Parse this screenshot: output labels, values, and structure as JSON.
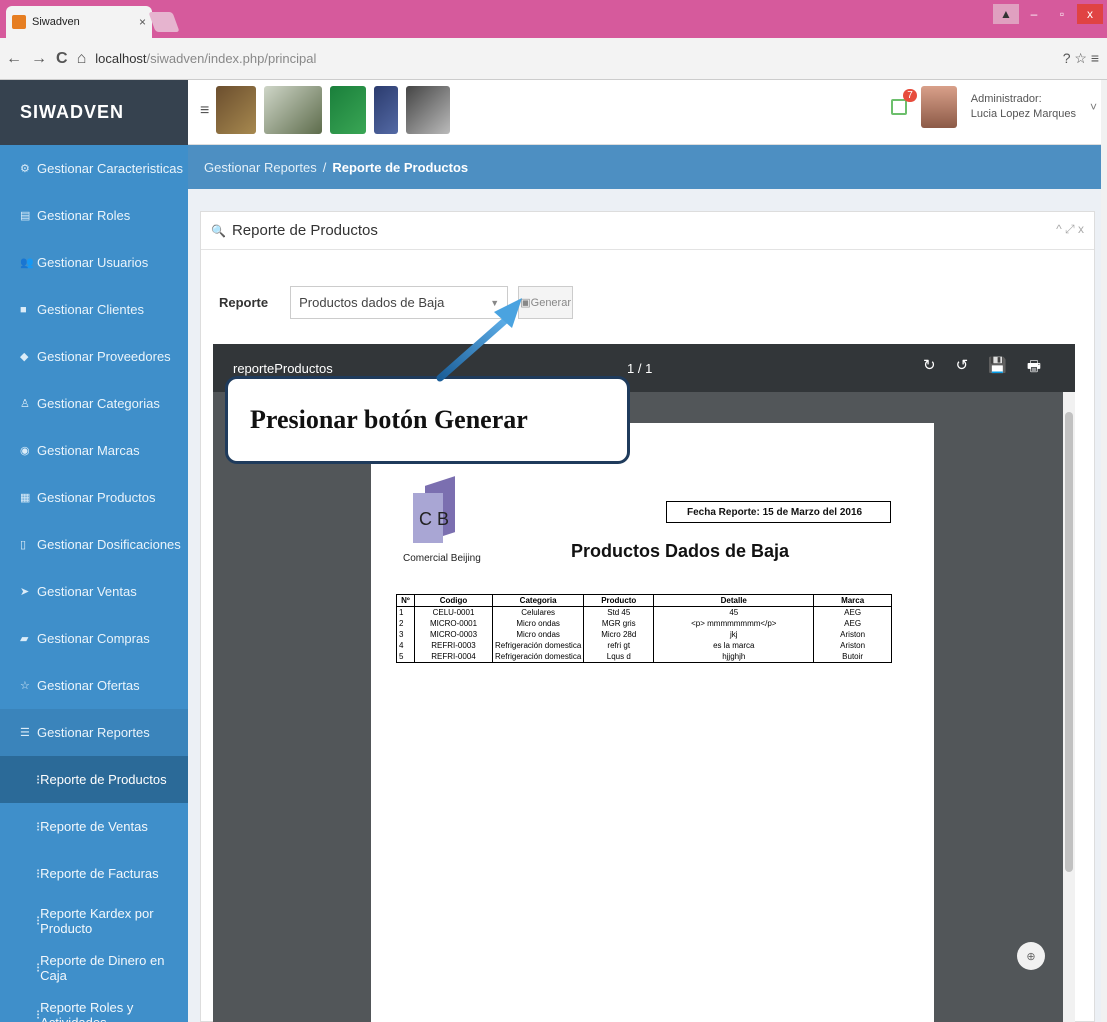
{
  "browser": {
    "tab_title": "Siwadven",
    "tab_close": "×",
    "url_host": "localhost",
    "url_path": "/siwadven/index.php/principal",
    "nav": {
      "back": "←",
      "forward": "→",
      "reload": "C",
      "home": "⌂"
    },
    "right_icons": "? ☆ ≡",
    "window": {
      "user": "▲",
      "minimize": "–",
      "maximize": "▫",
      "close": "x"
    }
  },
  "header": {
    "brand": "SIWADVEN",
    "hamburger": "≡",
    "notification_count": "7",
    "user_role": "Administrador:",
    "user_name": "Lucia Lopez Marques",
    "user_chevron": "˅"
  },
  "sidebar": {
    "items": [
      {
        "icon": "⚙",
        "label": "Gestionar Caracteristicas"
      },
      {
        "icon": "▤",
        "label": "Gestionar Roles"
      },
      {
        "icon": "👥",
        "label": "Gestionar Usuarios"
      },
      {
        "icon": "■",
        "label": "Gestionar Clientes"
      },
      {
        "icon": "◆",
        "label": "Gestionar Proveedores"
      },
      {
        "icon": "♙",
        "label": "Gestionar Categorias"
      },
      {
        "icon": "◉",
        "label": "Gestionar Marcas"
      },
      {
        "icon": "▦",
        "label": "Gestionar Productos"
      },
      {
        "icon": "▯",
        "label": "Gestionar Dosificaciones"
      },
      {
        "icon": "➤",
        "label": "Gestionar Ventas"
      },
      {
        "icon": "▰",
        "label": "Gestionar Compras"
      },
      {
        "icon": "☆",
        "label": "Gestionar Ofertas"
      },
      {
        "icon": "☰",
        "label": "Gestionar Reportes"
      }
    ],
    "subitems": [
      {
        "label": "Reporte de Productos"
      },
      {
        "label": "Reporte de Ventas"
      },
      {
        "label": "Reporte de Facturas"
      },
      {
        "label": "Reporte Kardex por Producto"
      },
      {
        "label": "Reporte de Dinero en Caja"
      },
      {
        "label": "Reporte Roles y Actividades"
      }
    ],
    "sub_icon": "⁝"
  },
  "breadcrumb": {
    "parent": "Gestionar Reportes",
    "separator": "/",
    "current": "Reporte de Productos"
  },
  "panel": {
    "title": "Reporte de Productos",
    "search_icon": "🔍",
    "tools": "^ ⤢ x",
    "report_label": "Reporte",
    "report_selected": "Productos dados de Baja",
    "generate_label": "Generar"
  },
  "viewer": {
    "filename": "reporteProductos",
    "pages": "1 / 1",
    "icons": [
      "↻",
      "↺",
      "💾",
      "🖶"
    ]
  },
  "report": {
    "logo_letters": "C B",
    "company": "Comercial Beijing",
    "date_label": "Fecha Reporte: 15 de Marzo del 2016",
    "title": "Productos Dados de Baja",
    "columns": [
      "Nº",
      "Codigo",
      "Categoria",
      "Producto",
      "Detalle",
      "Marca"
    ],
    "rows": [
      [
        "1",
        "CELU-0001",
        "Celulares",
        "Std 45",
        "45",
        "AEG"
      ],
      [
        "2",
        "MICRO-0001",
        "Micro ondas",
        "MGR gris",
        "<p> mmmmmmmm</p>",
        "AEG"
      ],
      [
        "3",
        "MICRO-0003",
        "Micro ondas",
        "Micro 28d",
        "jkj",
        "Ariston"
      ],
      [
        "4",
        "REFRI-0003",
        "Refrigeración domestica",
        "refri gt",
        "es la marca",
        "Ariston"
      ],
      [
        "5",
        "REFRI-0004",
        "Refrigeración domestica",
        "Lqus d",
        "hjjghjh",
        "Butoir"
      ]
    ]
  },
  "callout": {
    "text": "Presionar botón Generar"
  },
  "colors": {
    "sidebar": "#3f8fca",
    "brand_bar": "#36424f",
    "titlebar": "#d65a9c",
    "callout_border": "#1f3b5c",
    "arrow": "#2f86c9"
  }
}
